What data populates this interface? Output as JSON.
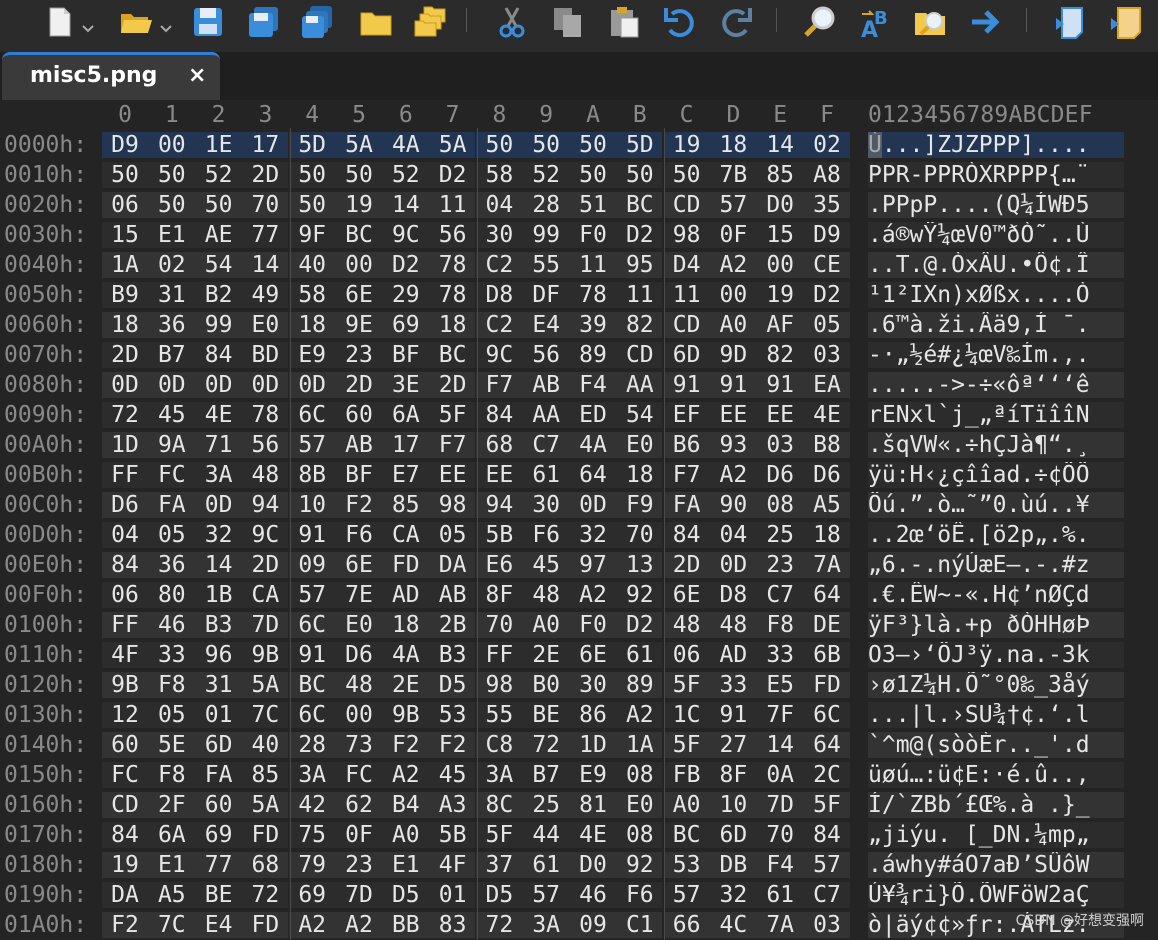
{
  "tab": {
    "title": "misc5.png",
    "close": "×"
  },
  "hex_header": {
    "columns": [
      "0",
      "1",
      "2",
      "3",
      "4",
      "5",
      "6",
      "7",
      "8",
      "9",
      "A",
      "B",
      "C",
      "D",
      "E",
      "F"
    ],
    "ascii": "0123456789ABCDEF"
  },
  "rows": [
    {
      "addr": "0000h:",
      "bytes": [
        "D9",
        "00",
        "1E",
        "17",
        "5D",
        "5A",
        "4A",
        "5A",
        "50",
        "50",
        "50",
        "5D",
        "19",
        "18",
        "14",
        "02"
      ],
      "ascii": "Ù...]ZJZPPP]...."
    },
    {
      "addr": "0010h:",
      "bytes": [
        "50",
        "50",
        "52",
        "2D",
        "50",
        "50",
        "52",
        "D2",
        "58",
        "52",
        "50",
        "50",
        "50",
        "7B",
        "85",
        "A8"
      ],
      "ascii": "PPR-PPRÒXRPPP{…¨"
    },
    {
      "addr": "0020h:",
      "bytes": [
        "06",
        "50",
        "50",
        "70",
        "50",
        "19",
        "14",
        "11",
        "04",
        "28",
        "51",
        "BC",
        "CD",
        "57",
        "D0",
        "35"
      ],
      "ascii": ".PPpP....(Q¼ÍWÐ5"
    },
    {
      "addr": "0030h:",
      "bytes": [
        "15",
        "E1",
        "AE",
        "77",
        "9F",
        "BC",
        "9C",
        "56",
        "30",
        "99",
        "F0",
        "D2",
        "98",
        "0F",
        "15",
        "D9"
      ],
      "ascii": ".á®wŸ¼œV0™ðÒ˜..Ù"
    },
    {
      "addr": "0040h:",
      "bytes": [
        "1A",
        "02",
        "54",
        "14",
        "40",
        "00",
        "D2",
        "78",
        "C2",
        "55",
        "11",
        "95",
        "D4",
        "A2",
        "00",
        "CE"
      ],
      "ascii": "..T.@.ÒxÂU.•Ô¢.Î"
    },
    {
      "addr": "0050h:",
      "bytes": [
        "B9",
        "31",
        "B2",
        "49",
        "58",
        "6E",
        "29",
        "78",
        "D8",
        "DF",
        "78",
        "11",
        "11",
        "00",
        "19",
        "D2"
      ],
      "ascii": "¹1²IXn)xØßx....Ò"
    },
    {
      "addr": "0060h:",
      "bytes": [
        "18",
        "36",
        "99",
        "E0",
        "18",
        "9E",
        "69",
        "18",
        "C2",
        "E4",
        "39",
        "82",
        "CD",
        "A0",
        "AF",
        "05"
      ],
      "ascii": ".6™à.ži.Âä9‚Í ¯."
    },
    {
      "addr": "0070h:",
      "bytes": [
        "2D",
        "B7",
        "84",
        "BD",
        "E9",
        "23",
        "BF",
        "BC",
        "9C",
        "56",
        "89",
        "CD",
        "6D",
        "9D",
        "82",
        "03"
      ],
      "ascii": "-·„½é#¿¼œV‰Ím.‚."
    },
    {
      "addr": "0080h:",
      "bytes": [
        "0D",
        "0D",
        "0D",
        "0D",
        "0D",
        "2D",
        "3E",
        "2D",
        "F7",
        "AB",
        "F4",
        "AA",
        "91",
        "91",
        "91",
        "EA"
      ],
      "ascii": ".....->-÷«ôª‘‘‘ê"
    },
    {
      "addr": "0090h:",
      "bytes": [
        "72",
        "45",
        "4E",
        "78",
        "6C",
        "60",
        "6A",
        "5F",
        "84",
        "AA",
        "ED",
        "54",
        "EF",
        "EE",
        "EE",
        "4E"
      ],
      "ascii": "rENxl`j_„ªíTïîîN"
    },
    {
      "addr": "00A0h:",
      "bytes": [
        "1D",
        "9A",
        "71",
        "56",
        "57",
        "AB",
        "17",
        "F7",
        "68",
        "C7",
        "4A",
        "E0",
        "B6",
        "93",
        "03",
        "B8"
      ],
      "ascii": ".šqVW«.÷hÇJà¶“.¸"
    },
    {
      "addr": "00B0h:",
      "bytes": [
        "FF",
        "FC",
        "3A",
        "48",
        "8B",
        "BF",
        "E7",
        "EE",
        "EE",
        "61",
        "64",
        "18",
        "F7",
        "A2",
        "D6",
        "D6"
      ],
      "ascii": "ÿü:H‹¿çîîad.÷¢ÖÖ"
    },
    {
      "addr": "00C0h:",
      "bytes": [
        "D6",
        "FA",
        "0D",
        "94",
        "10",
        "F2",
        "85",
        "98",
        "94",
        "30",
        "0D",
        "F9",
        "FA",
        "90",
        "08",
        "A5"
      ],
      "ascii": "Öú.”.ò…˜”0.ùú..¥"
    },
    {
      "addr": "00D0h:",
      "bytes": [
        "04",
        "05",
        "32",
        "9C",
        "91",
        "F6",
        "CA",
        "05",
        "5B",
        "F6",
        "32",
        "70",
        "84",
        "04",
        "25",
        "18"
      ],
      "ascii": "..2œ‘öÊ.[ö2p„.%."
    },
    {
      "addr": "00E0h:",
      "bytes": [
        "84",
        "36",
        "14",
        "2D",
        "09",
        "6E",
        "FD",
        "DA",
        "E6",
        "45",
        "97",
        "13",
        "2D",
        "0D",
        "23",
        "7A"
      ],
      "ascii": "„6.-.nýÚæE—.-.#z"
    },
    {
      "addr": "00F0h:",
      "bytes": [
        "06",
        "80",
        "1B",
        "CA",
        "57",
        "7E",
        "AD",
        "AB",
        "8F",
        "48",
        "A2",
        "92",
        "6E",
        "D8",
        "C7",
        "64"
      ],
      "ascii": ".€.ÊW~-«.H¢’nØÇd"
    },
    {
      "addr": "0100h:",
      "bytes": [
        "FF",
        "46",
        "B3",
        "7D",
        "6C",
        "E0",
        "18",
        "2B",
        "70",
        "A0",
        "F0",
        "D2",
        "48",
        "48",
        "F8",
        "DE"
      ],
      "ascii": "ÿF³}là.+p ðÒHHøÞ"
    },
    {
      "addr": "0110h:",
      "bytes": [
        "4F",
        "33",
        "96",
        "9B",
        "91",
        "D6",
        "4A",
        "B3",
        "FF",
        "2E",
        "6E",
        "61",
        "06",
        "AD",
        "33",
        "6B"
      ],
      "ascii": "O3–›‘ÖJ³ÿ.na.-3k"
    },
    {
      "addr": "0120h:",
      "bytes": [
        "9B",
        "F8",
        "31",
        "5A",
        "BC",
        "48",
        "2E",
        "D5",
        "98",
        "B0",
        "30",
        "89",
        "5F",
        "33",
        "E5",
        "FD"
      ],
      "ascii": "›ø1Z¼H.Õ˜°0‰_3åý"
    },
    {
      "addr": "0130h:",
      "bytes": [
        "12",
        "05",
        "01",
        "7C",
        "6C",
        "00",
        "9B",
        "53",
        "55",
        "BE",
        "86",
        "A2",
        "1C",
        "91",
        "7F",
        "6C"
      ],
      "ascii": "...|l.›SU¾†¢.‘.l"
    },
    {
      "addr": "0140h:",
      "bytes": [
        "60",
        "5E",
        "6D",
        "40",
        "28",
        "73",
        "F2",
        "F2",
        "C8",
        "72",
        "1D",
        "1A",
        "5F",
        "27",
        "14",
        "64"
      ],
      "ascii": "`^m@(sòòÈr.._'.d"
    },
    {
      "addr": "0150h:",
      "bytes": [
        "FC",
        "F8",
        "FA",
        "85",
        "3A",
        "FC",
        "A2",
        "45",
        "3A",
        "B7",
        "E9",
        "08",
        "FB",
        "8F",
        "0A",
        "2C"
      ],
      "ascii": "üøú…:ü¢E:·é.û..,"
    },
    {
      "addr": "0160h:",
      "bytes": [
        "CD",
        "2F",
        "60",
        "5A",
        "42",
        "62",
        "B4",
        "A3",
        "8C",
        "25",
        "81",
        "E0",
        "A0",
        "10",
        "7D",
        "5F"
      ],
      "ascii": "Í/`ZBb´£Œ%.à .}_"
    },
    {
      "addr": "0170h:",
      "bytes": [
        "84",
        "6A",
        "69",
        "FD",
        "75",
        "0F",
        "A0",
        "5B",
        "5F",
        "44",
        "4E",
        "08",
        "BC",
        "6D",
        "70",
        "84"
      ],
      "ascii": "„jiýu. [_DN.¼mp„"
    },
    {
      "addr": "0180h:",
      "bytes": [
        "19",
        "E1",
        "77",
        "68",
        "79",
        "23",
        "E1",
        "4F",
        "37",
        "61",
        "D0",
        "92",
        "53",
        "DB",
        "F4",
        "57"
      ],
      "ascii": ".áwhy#áO7aÐ’SÛôW"
    },
    {
      "addr": "0190h:",
      "bytes": [
        "DA",
        "A5",
        "BE",
        "72",
        "69",
        "7D",
        "D5",
        "01",
        "D5",
        "57",
        "46",
        "F6",
        "57",
        "32",
        "61",
        "C7"
      ],
      "ascii": "Ú¥¾ri}Õ.ÕWFöW2aÇ"
    },
    {
      "addr": "01A0h:",
      "bytes": [
        "F2",
        "7C",
        "E4",
        "FD",
        "A2",
        "A2",
        "BB",
        "83",
        "72",
        "3A",
        "09",
        "C1",
        "66",
        "4C",
        "7A",
        "03"
      ],
      "ascii": "ò|äý¢¢»ƒr:.ÁfLz."
    }
  ],
  "watermark": "CSDN @好想变强啊",
  "icons": {
    "new": "new-file-icon",
    "open": "open-folder-icon",
    "save": "save-icon",
    "save_as": "save-as-icon",
    "save_all": "save-all-icon",
    "folder": "folder-icon",
    "folders": "folders-icon",
    "cut": "cut-icon",
    "copy": "copy-icon",
    "paste": "paste-icon",
    "undo": "undo-icon",
    "redo": "redo-icon",
    "find": "find-icon",
    "replace": "replace-icon",
    "find_files": "find-in-files-icon",
    "goto": "goto-icon",
    "scroll1": "scroll-icon",
    "scroll2": "script-icon"
  },
  "colors": {
    "selection": "#223654",
    "tab_accent": "#2d7fd6",
    "icon_blue": "#3a8ddb",
    "icon_yellow": "#e8b923"
  }
}
